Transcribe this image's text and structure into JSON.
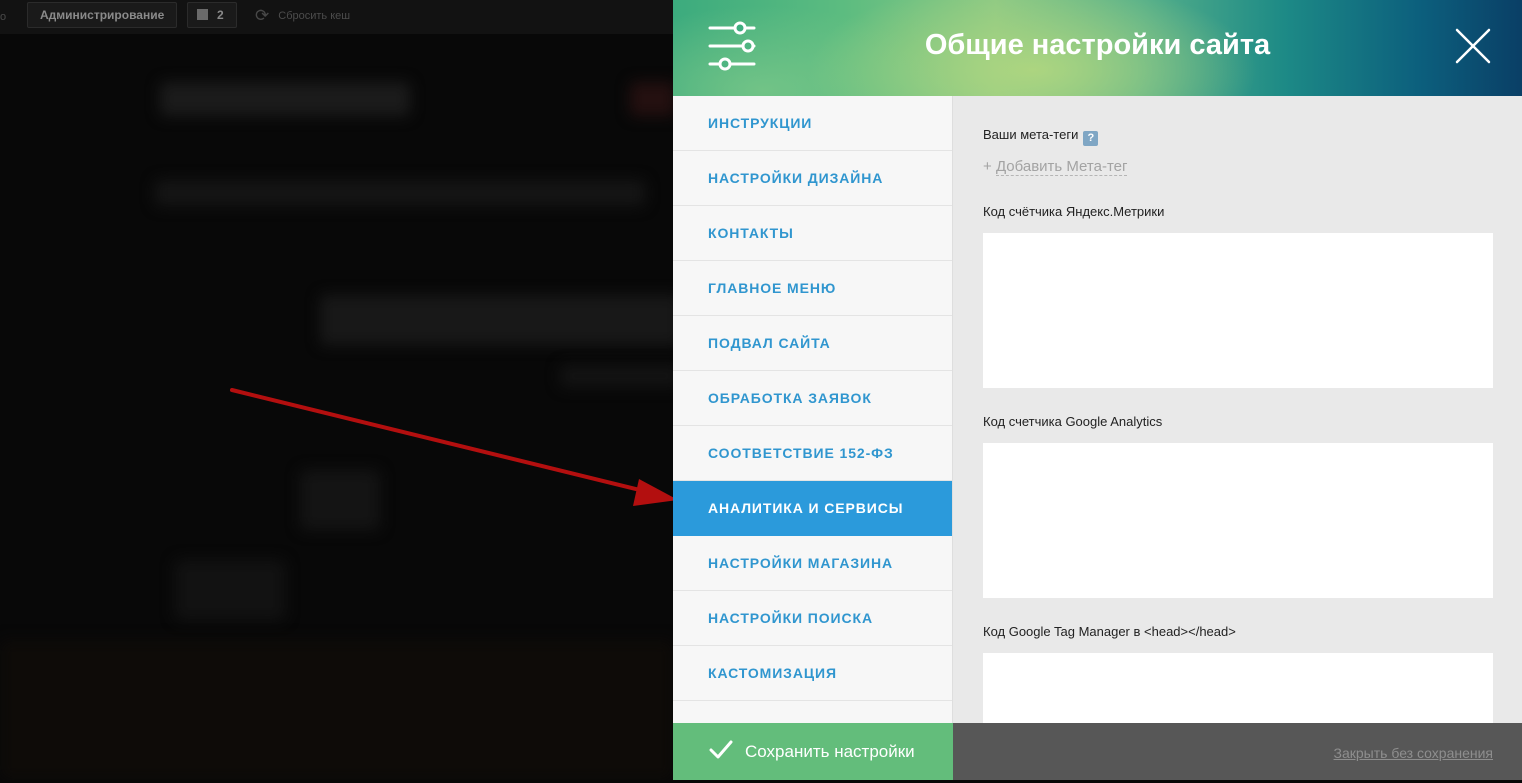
{
  "admin_bar": {
    "cut_text": "о",
    "admin_label": "Администрирование",
    "comments_count": "2",
    "reset_cache_label": "Сбросить кеш"
  },
  "panel": {
    "title": "Общие настройки сайта",
    "sidebar_items": [
      {
        "label": "Инструкции",
        "active": false
      },
      {
        "label": "Настройки дизайна",
        "active": false
      },
      {
        "label": "Контакты",
        "active": false
      },
      {
        "label": "Главное меню",
        "active": false
      },
      {
        "label": "Подвал сайта",
        "active": false
      },
      {
        "label": "Обработка заявок",
        "active": false
      },
      {
        "label": "Соответствие 152-ФЗ",
        "active": false
      },
      {
        "label": "Аналитика и сервисы",
        "active": true
      },
      {
        "label": "Настройки магазина",
        "active": false
      },
      {
        "label": "Настройки поиска",
        "active": false
      },
      {
        "label": "Кастомизация",
        "active": false
      }
    ],
    "content": {
      "meta_tags_label": "Ваши мета-теги",
      "help_glyph": "?",
      "add_meta_plus": "+",
      "add_meta_label": "Добавить Мета-тег",
      "yandex_label": "Код счётчика Яндекс.Метрики",
      "yandex_value": "",
      "ga_label": "Код счетчика Google Analytics",
      "ga_value": "",
      "gtm_label": "Код Google Tag Manager в <head></head>",
      "gtm_value": ""
    },
    "footer": {
      "save_label": "Сохранить настройки",
      "close_label": "Закрыть без сохранения"
    }
  },
  "colors": {
    "accent_blue": "#2b9adb",
    "save_green": "#63bd7b",
    "arrow_red": "#b30f0f"
  },
  "icons": {
    "settings": "sliders-icon",
    "close": "close-icon",
    "help": "help-icon",
    "save": "check-icon"
  }
}
